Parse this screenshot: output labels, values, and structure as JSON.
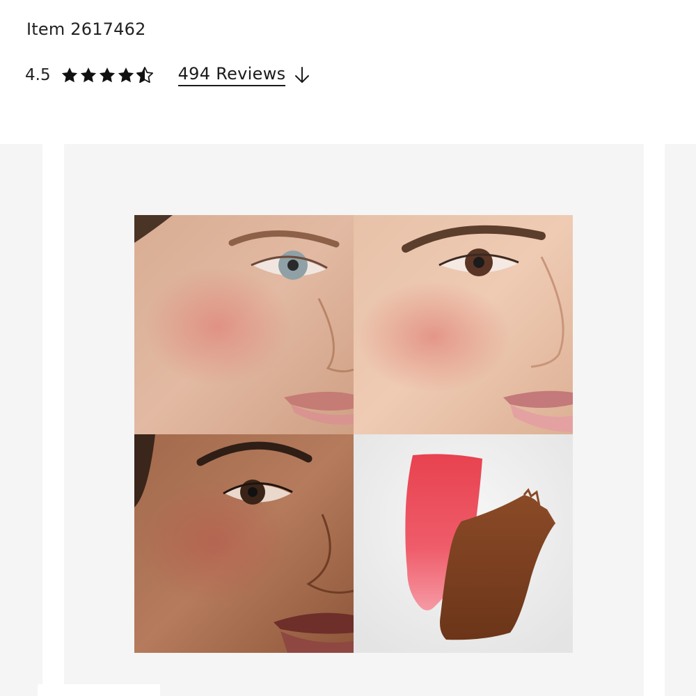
{
  "product": {
    "item_number": "Item 2617462",
    "rating": {
      "value": "4.5",
      "stars": 4.5,
      "max_stars": 5,
      "star_color": "#111111"
    },
    "reviews_link": "494 Reviews",
    "reviews_icon": "arrow-down-icon"
  },
  "gallery": {
    "background": "#f5f5f5",
    "image_description_icons": [
      "face-model-1",
      "face-model-2",
      "face-model-3",
      "product-swatches"
    ],
    "swatch_colors": {
      "pink": "#ee4a5c",
      "brown": "#7a3d1f"
    }
  }
}
